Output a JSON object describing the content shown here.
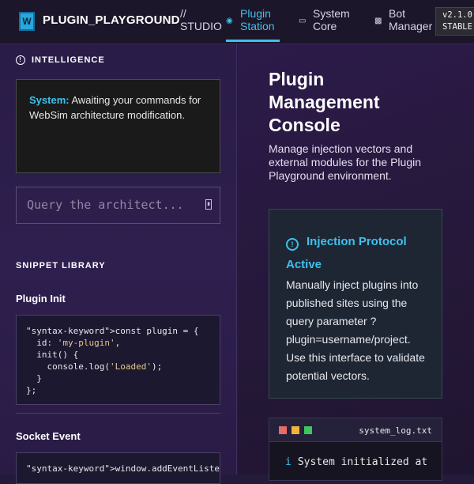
{
  "header": {
    "logo_letter": "W",
    "app_name": "PLUGIN_PLAYGROUND",
    "app_sub": "// STUDIO",
    "nav": [
      {
        "label": "Plugin Station",
        "icon": "globe-icon",
        "active": true
      },
      {
        "label": "System Core",
        "icon": "monitor-icon",
        "active": false
      },
      {
        "label": "Bot Manager",
        "icon": "bot-icon",
        "active": false
      }
    ],
    "version": "v2.1.0",
    "channel": "STABLE"
  },
  "sidebar": {
    "intelligence_heading": "INTELLIGENCE",
    "message_sender": "System:",
    "message_text": "Awaiting your commands for WebSim architecture modification.",
    "query_placeholder": "Query the architect...",
    "snippet_heading": "SNIPPET LIBRARY",
    "snippets": [
      {
        "title": "Plugin Init",
        "code_lines": [
          "\"syntax-keyword\">const plugin = {",
          "  id: 'my-plugin',",
          "  init() {",
          "    console.log('Loaded');",
          "  }",
          "};"
        ]
      },
      {
        "title": "Socket Event",
        "code_lines": [
          "\"syntax-keyword\">window.addEventListe"
        ]
      }
    ]
  },
  "main": {
    "title": "Plugin Management Console",
    "description": "Manage injection vectors and external modules for the Plugin Playground environment.",
    "protocol_title": "Injection Protocol Active",
    "protocol_body": "Manually inject plugins into published sites using the query parameter ?plugin=username/project. Use this interface to validate potential vectors.",
    "terminal_file": "system_log.txt",
    "terminal_line_icon": "i",
    "terminal_line": "System initialized at"
  },
  "colors": {
    "accent": "#3fc1ec",
    "dot_red": "#e86a6a",
    "dot_yellow": "#f0b43a",
    "dot_green": "#3ec45e"
  }
}
